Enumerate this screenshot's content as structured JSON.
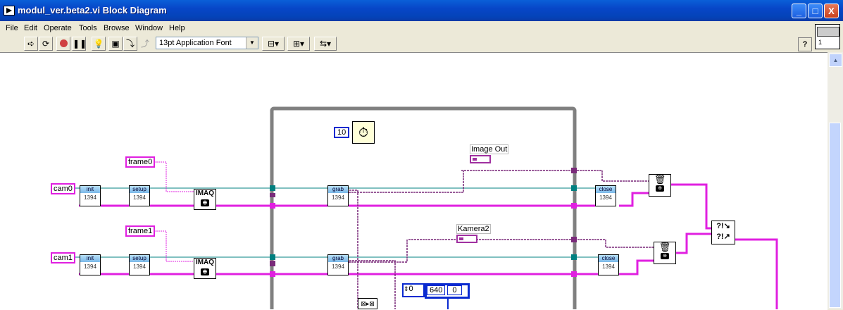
{
  "window": {
    "title": "modul_ver.beta2.vi Block Diagram",
    "buttons": {
      "minimize": "_",
      "maximize": "□",
      "close": "X"
    }
  },
  "menu": [
    "File",
    "Edit",
    "Operate",
    "Tools",
    "Browse",
    "Window",
    "Help"
  ],
  "toolbar": {
    "font": "13pt Application Font",
    "help_label": "?",
    "vi_icon_number": "1"
  },
  "diagram": {
    "camera_names": {
      "cam0": "cam0",
      "cam1": "cam1"
    },
    "frame_names": {
      "frame0": "frame0",
      "frame1": "frame1"
    },
    "image_out_label": "Image Out",
    "kamera2_label": "Kamera2",
    "wait_ms": "10",
    "init_label": "init",
    "bus_label": "1394",
    "setup_label": "setup",
    "grab_label": "grab",
    "close_label": "close",
    "imaq_label": "IMAQ",
    "cluster_values": {
      "a": "0",
      "b": "640",
      "c": "0"
    },
    "merge_errors_label": "?!"
  },
  "colors": {
    "titlebar": "#0746c8",
    "frame_wire": "#e020e0",
    "session_wire": "#008080",
    "error_wire": "#7a2a7a",
    "while_loop_border": "#808080"
  }
}
